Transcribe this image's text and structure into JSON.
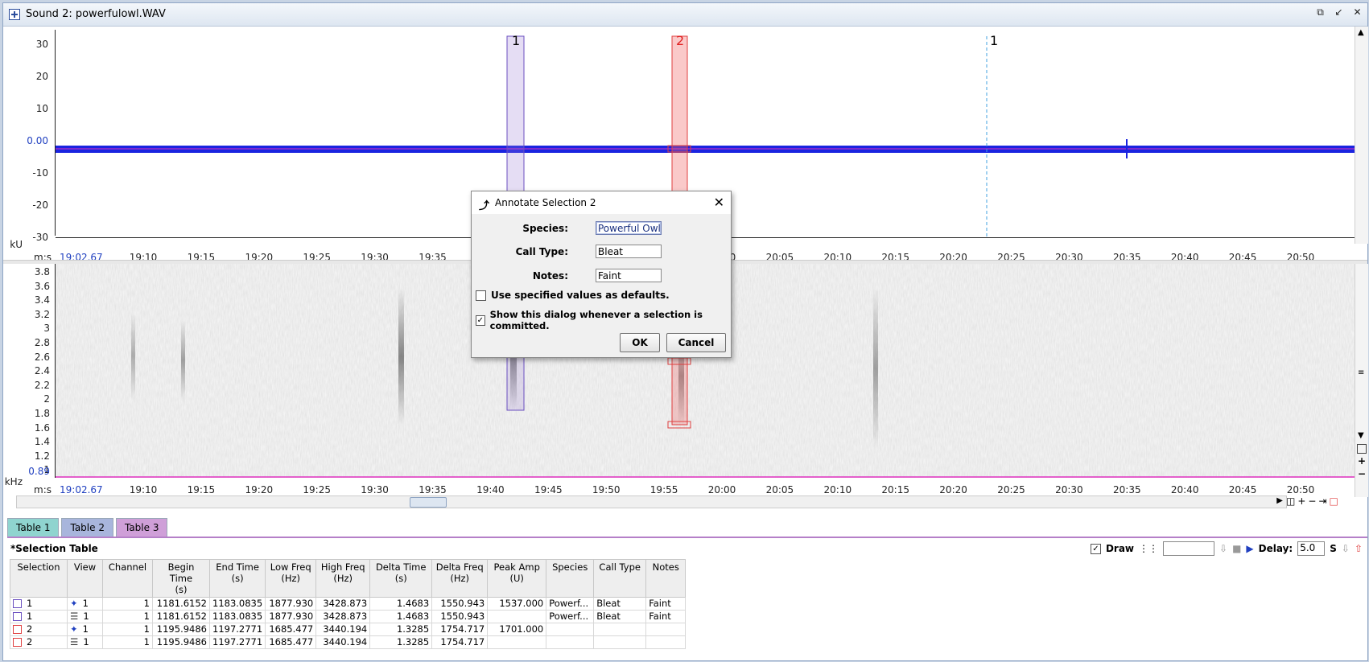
{
  "window": {
    "title": "Sound 2: powerfulowl.WAV"
  },
  "waveform": {
    "unit": "kU",
    "time_label": "m:s",
    "start_time": "19:02.67",
    "y_ticks": [
      "30",
      "20",
      "10",
      "0.00",
      "-10",
      "-20",
      "-30"
    ],
    "x_ticks": [
      "19:10",
      "19:15",
      "19:20",
      "19:25",
      "19:30",
      "19:35",
      "19:40",
      "19:45",
      "19:50",
      "19:55",
      "20:00",
      "20:05",
      "20:10",
      "20:15",
      "20:20",
      "20:25",
      "20:30",
      "20:35",
      "20:40",
      "20:45",
      "20:50"
    ],
    "selection_labels": [
      "1",
      "2",
      "1"
    ]
  },
  "spectrogram": {
    "unit": "kHz",
    "time_label": "m:s",
    "start_time": "19:02.67",
    "y_ticks": [
      "3.8",
      "3.6",
      "3.4",
      "3.2",
      "3",
      "2.8",
      "2.6",
      "2.4",
      "2.2",
      "2",
      "1.8",
      "1.6",
      "1.4",
      "1.2",
      "1",
      "0.89"
    ]
  },
  "tabs": [
    "Table 1",
    "Table 2",
    "Table 3"
  ],
  "table": {
    "title": "*Selection Table",
    "draw_label": "Draw",
    "delay_label": "Delay:",
    "delay_value": "5.0",
    "delay_unit": "S",
    "headers": [
      [
        "Selection",
        ""
      ],
      [
        "View",
        ""
      ],
      [
        "Channel",
        ""
      ],
      [
        "Begin Time",
        "(s)"
      ],
      [
        "End Time",
        "(s)"
      ],
      [
        "Low Freq",
        "(Hz)"
      ],
      [
        "High Freq",
        "(Hz)"
      ],
      [
        "Delta Time",
        "(s)"
      ],
      [
        "Delta Freq",
        "(Hz)"
      ],
      [
        "Peak Amp",
        "(U)"
      ],
      [
        "Species",
        ""
      ],
      [
        "Call Type",
        ""
      ],
      [
        "Notes",
        ""
      ]
    ],
    "rows": [
      {
        "sel": "1",
        "color": "#6a4fc0",
        "view": "1",
        "view_icon": "waveform-icon",
        "channel": "1",
        "begin": "1181.6152",
        "end": "1183.0835",
        "low": "1877.930",
        "high": "3428.873",
        "dt": "1.4683",
        "df": "1550.943",
        "peak": "1537.000",
        "species": "Powerf...",
        "call": "Bleat",
        "notes": "Faint"
      },
      {
        "sel": "1",
        "color": "#6a4fc0",
        "view": "1",
        "view_icon": "spectrogram-icon",
        "channel": "1",
        "begin": "1181.6152",
        "end": "1183.0835",
        "low": "1877.930",
        "high": "3428.873",
        "dt": "1.4683",
        "df": "1550.943",
        "peak": "",
        "species": "Powerf...",
        "call": "Bleat",
        "notes": "Faint"
      },
      {
        "sel": "2",
        "color": "#e04040",
        "view": "1",
        "view_icon": "waveform-icon",
        "channel": "1",
        "begin": "1195.9486",
        "end": "1197.2771",
        "low": "1685.477",
        "high": "3440.194",
        "dt": "1.3285",
        "df": "1754.717",
        "peak": "1701.000",
        "species": "",
        "call": "",
        "notes": ""
      },
      {
        "sel": "2",
        "color": "#e04040",
        "view": "1",
        "view_icon": "spectrogram-icon",
        "channel": "1",
        "begin": "1195.9486",
        "end": "1197.2771",
        "low": "1685.477",
        "high": "3440.194",
        "dt": "1.3285",
        "df": "1754.717",
        "peak": "",
        "species": "",
        "call": "",
        "notes": ""
      }
    ]
  },
  "dialog": {
    "title": "Annotate Selection 2",
    "species_label": "Species:",
    "species_value": "Powerful Owl",
    "calltype_label": "Call Type:",
    "calltype_value": "Bleat",
    "notes_label": "Notes:",
    "notes_value": "Faint",
    "defaults_label": "Use specified values as defaults.",
    "defaults_checked": false,
    "show_label": "Show this dialog whenever a selection is committed.",
    "show_checked": true,
    "ok_label": "OK",
    "cancel_label": "Cancel"
  }
}
